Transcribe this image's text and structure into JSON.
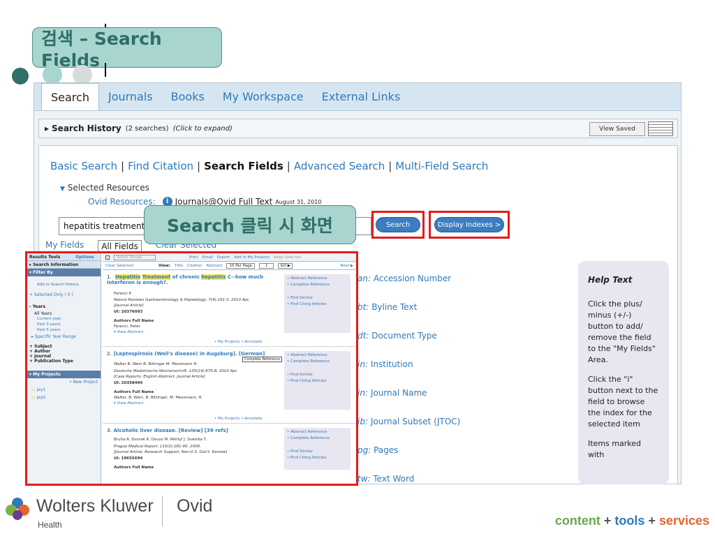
{
  "slide": {
    "title": "검색 – Search Fields",
    "callout": "Search 클릭 시 화면"
  },
  "nav": {
    "tabs": [
      "Search",
      "Journals",
      "Books",
      "My Workspace",
      "External Links"
    ],
    "active": "Search"
  },
  "history": {
    "label": "Search History",
    "count": "(2 searches)",
    "hint": "(Click to expand)",
    "view_saved": "View Saved"
  },
  "modes": {
    "items": [
      "Basic Search",
      "Find Citation",
      "Search Fields",
      "Advanced Search",
      "Multi-Field Search"
    ],
    "active": "Search Fields"
  },
  "resources": {
    "selected": "Selected Resources",
    "ovid_label": "Ovid Resources:",
    "journal": "Journals@Ovid Full Text",
    "journal_date": "August 31, 2010"
  },
  "search": {
    "value": "hepatitis treatment",
    "button": "Search",
    "index_button": "Display Indexes >"
  },
  "field_tabs": {
    "my_fields": "My Fields",
    "all_fields": "All Fields",
    "clear": "Clear Selected"
  },
  "fields": [
    {
      "code": "an:",
      "name": "Accession Number"
    },
    {
      "code": "bt:",
      "name": "Byline Text"
    },
    {
      "code": "dt:",
      "name": "Document Type"
    },
    {
      "code": "in:",
      "name": "Institution"
    },
    {
      "code": "jn:",
      "name": "Journal Name"
    },
    {
      "code": "jb:",
      "name": "Journal Subset (JTOC)"
    },
    {
      "code": "pg:",
      "name": "Pages"
    },
    {
      "code": "tw:",
      "name": "Text Word"
    }
  ],
  "help": {
    "title": "Help Text",
    "p1": "Click the plus/ minus (+/-) button to add/ remove the field to the \"My Fields\" Area.",
    "p2": "Click the \"i\" button next to the field to browse the index for the selected item",
    "p3": "Items marked with"
  },
  "inset": {
    "left": {
      "results_tools": "Results Tools",
      "options": "Options",
      "search_info": "▸ Search Information",
      "filter_by": "▾ Filter By",
      "add_history": "Add to Search History",
      "selected_only": "+ Selected Only ( 0 )",
      "years": "- Years",
      "all_years": "All Years",
      "current_year": "Current year",
      "past3": "Past 3 years",
      "past5": "Past 5 years",
      "specific": "▸ Specific Year Range",
      "subject": "+ Subject",
      "author": "+ Author",
      "journal": "+ Journal",
      "pubtype": "+ Publication Type",
      "my_projects": "▾ My Projects",
      "new_project": "• New Project",
      "proj1": "jay1",
      "proj2": "jay2"
    },
    "toolbar": {
      "select_range": "Select Range",
      "print": "Print",
      "email": "Email",
      "export": "Export",
      "add_projects": "Add to My Projects",
      "keep": "Keep Selected",
      "clear": "Clear Selected",
      "view": "View:",
      "title": "Title",
      "citation": "Citation",
      "abstract": "Abstract",
      "per_page": "10 Per Page",
      "page": "1",
      "go": "GO ▶",
      "next": "Next ▶"
    },
    "records": [
      {
        "num": "1.",
        "t1": "Hepatitis",
        "t2": "Treatment",
        "t3": "of chronic",
        "t4": "hepatitis",
        "t5": "C--how much interferon is enough?.",
        "authors": "Ferenci P.",
        "source": "Nature Reviews Gastroenterology & Hepatology. 7(4):191-3, 2010 Apr.",
        "type": "[Journal Article]",
        "ui": "UI: 20376093",
        "afn": "Authors Full Name",
        "afn_val": "Ferenci, Peter.",
        "view": "▾ View Abstract"
      },
      {
        "num": "2.",
        "title": "[Leptospirosis (Weil's disease) in Augsburg]. [German]",
        "tooltip": "Complete Reference",
        "authors": "Walter B. Wein B. Bittinger M. Messmann H.",
        "source": "Deutsche Medizinische Wochenschrift. 135(14):675-8, 2010 Apr.",
        "type": "[Case Reports. English Abstract. Journal Article]",
        "ui": "UI: 20358494",
        "afn": "Authors Full Name",
        "afn_val": "Walter, B. Wein, B. Bittinger, M. Messmann, H.",
        "view": "▾ View Abstract"
      },
      {
        "num": "3.",
        "title": "Alcoholic liver disease. [Review] [39 refs]",
        "authors": "Bruha R. Dvorak K. Douss M. Petrtyl J. Svestka T.",
        "source": "Prague Medical Report. 110(3):181-90, 2009.",
        "type": "[Journal Article. Research Support, Non-U.S. Gov't. Review]",
        "ui": "UI: 19655694",
        "afn": "Authors Full Name"
      }
    ],
    "links": {
      "abs": "• Abstract Reference",
      "comp": "• Complete Reference",
      "similar": "• Find Similar",
      "citing": "• Find Citing Articles",
      "projects": "• My Projects",
      "annotate": "• Annotate"
    }
  },
  "footer": {
    "company": "Wolters Kluwer",
    "health": "Health",
    "product": "Ovid",
    "t_content": "content",
    "t_plus": "+",
    "t_tools": "tools",
    "t_services": "services"
  }
}
